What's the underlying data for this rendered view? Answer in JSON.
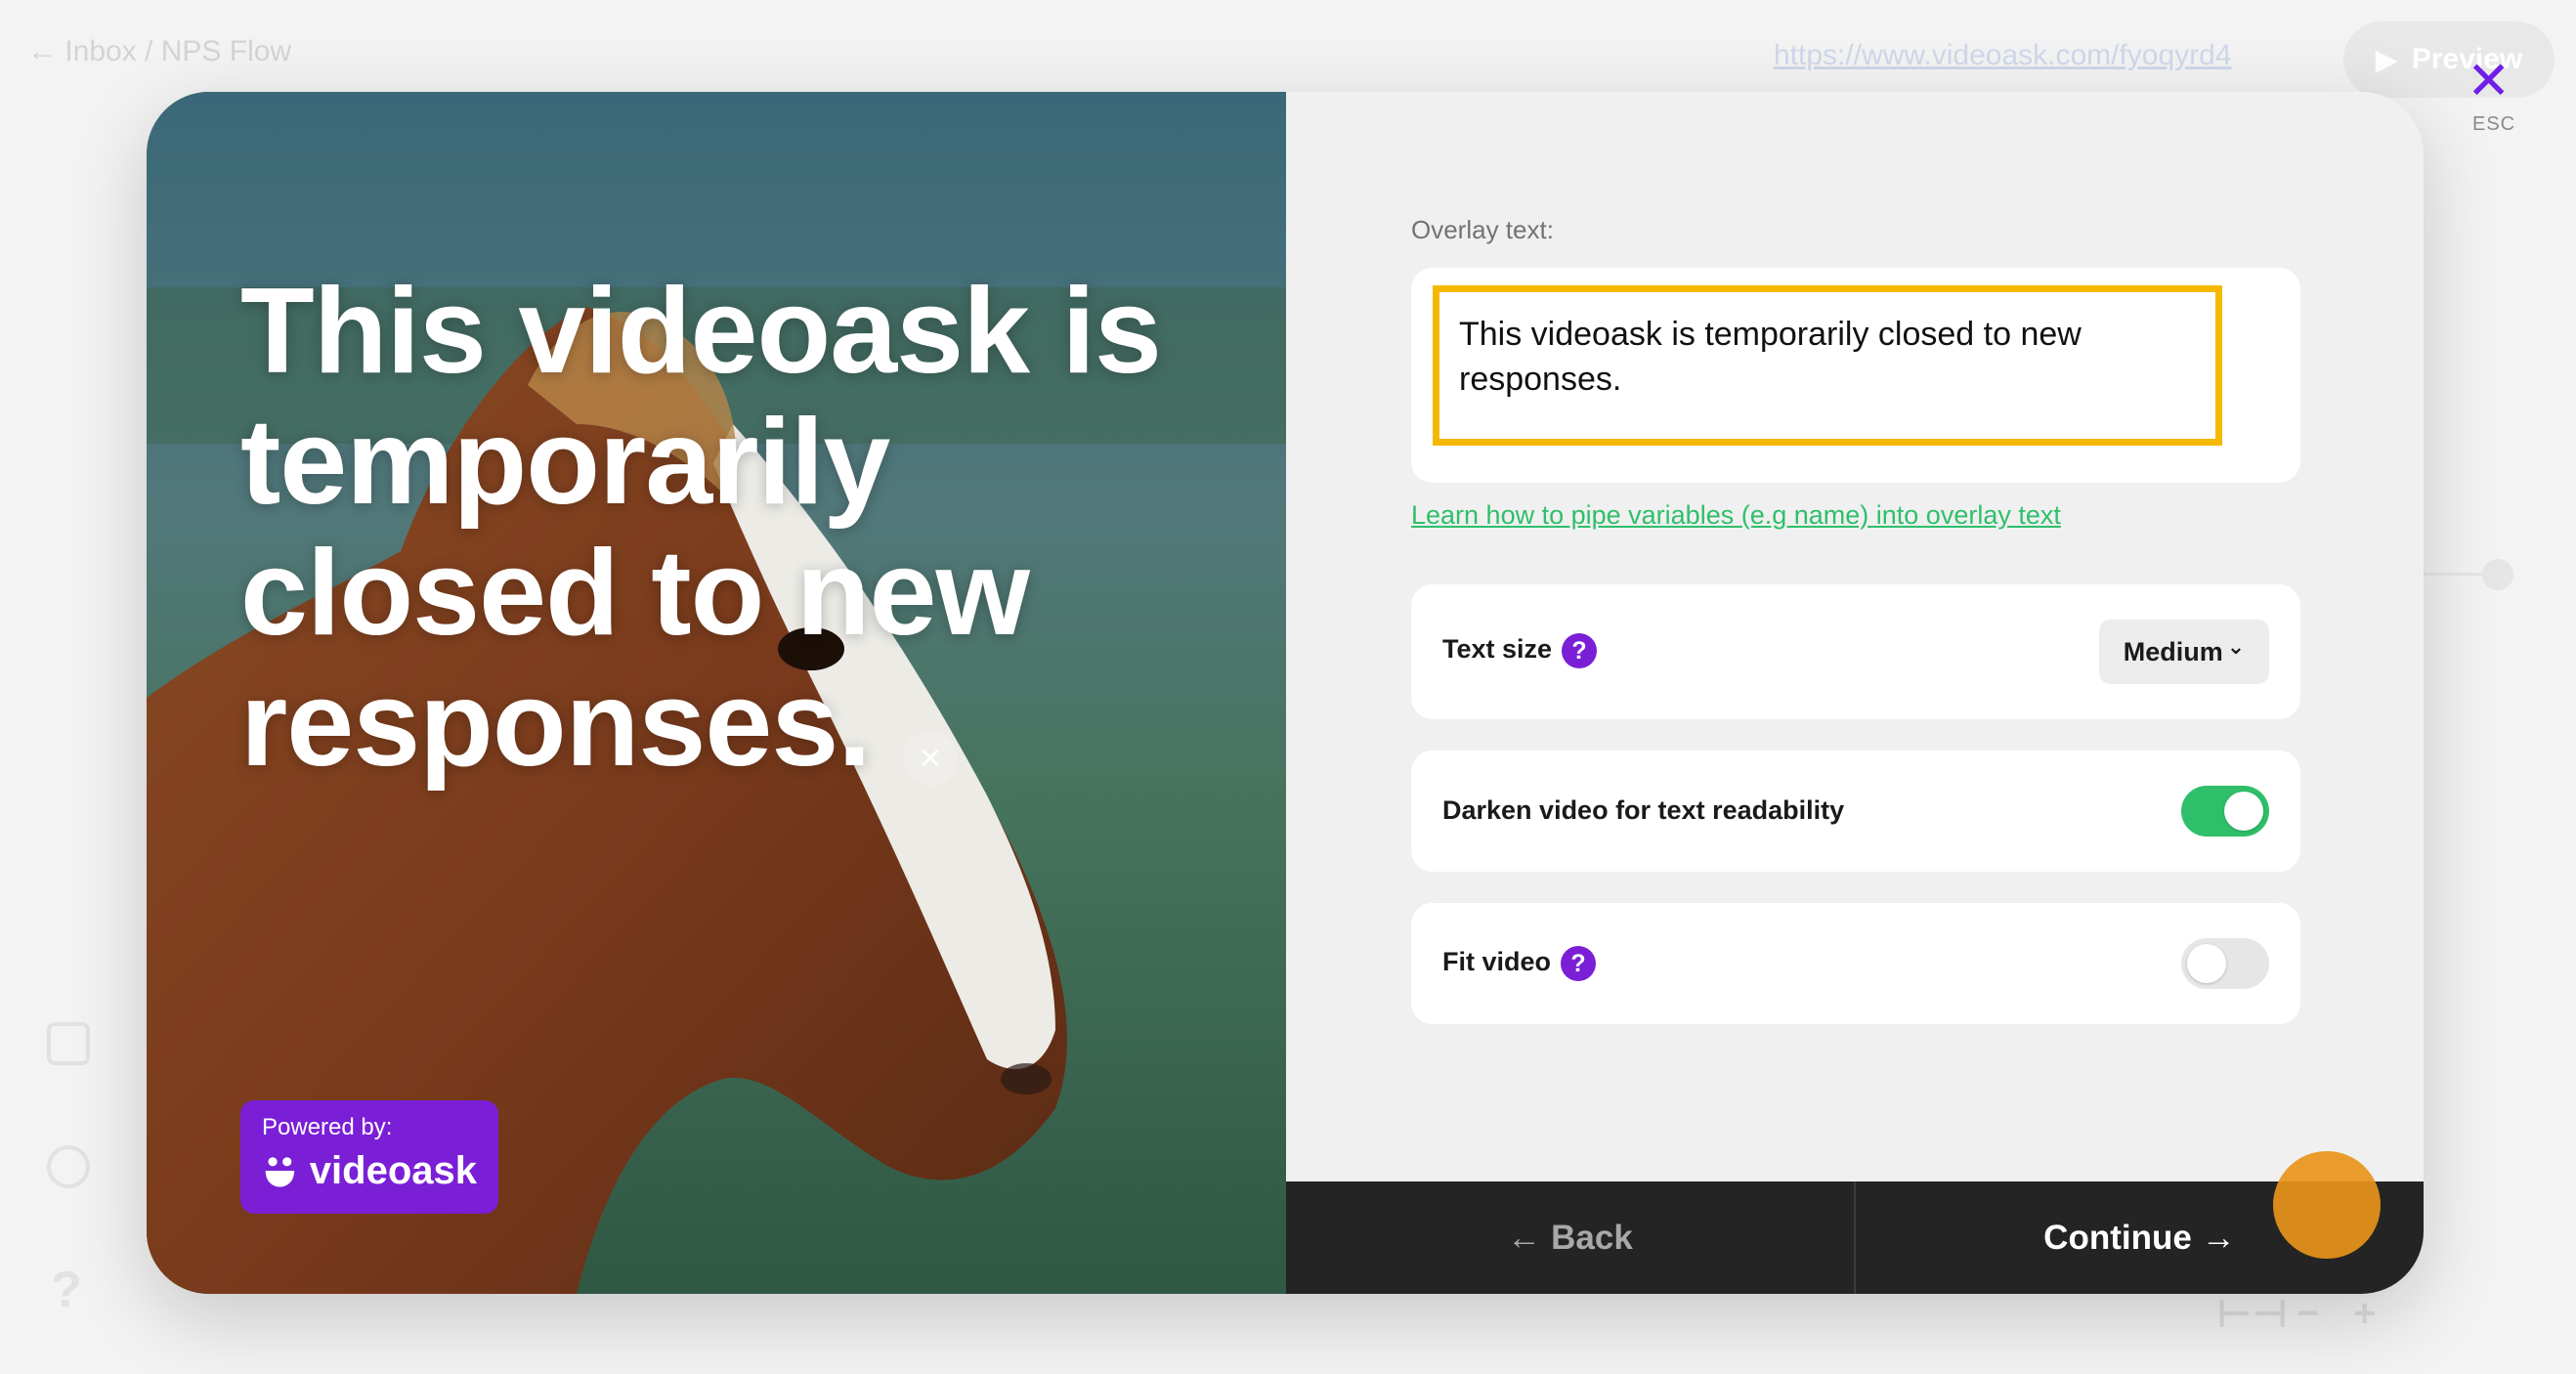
{
  "background": {
    "breadcrumb": "← Inbox / NPS Flow",
    "url": "https://www.videoask.com/fyoqyrd4",
    "preview_label": "Preview",
    "zoom_controls": [
      "⊢⊣",
      "−",
      "+"
    ]
  },
  "close": {
    "label": "✕",
    "hint": "ESC"
  },
  "video_preview": {
    "overlay_text": "This videoask is temporarily closed to new responses.",
    "dismiss_icon": "×",
    "powered_by": "Powered by:",
    "brand": "videoask"
  },
  "settings": {
    "overlay_label": "Overlay text:",
    "overlay_value": "This videoask is temporarily closed to new responses.",
    "help_link": "Learn how to pipe variables (e.g name) into overlay text",
    "text_size": {
      "label": "Text size",
      "help": "?",
      "value": "Medium",
      "chevron": "⌄"
    },
    "darken": {
      "label": "Darken video for text readability",
      "enabled": true
    },
    "fit_video": {
      "label": "Fit video",
      "help": "?",
      "enabled": false
    }
  },
  "footer": {
    "back": {
      "arrow": "←",
      "label": "Back"
    },
    "continue": {
      "label": "Continue",
      "arrow": "→"
    }
  },
  "colors": {
    "accent": "#7a1fd6",
    "toggle_on": "#2fbf6a",
    "highlight_border": "#f5b800",
    "footer_bg": "#242424"
  }
}
